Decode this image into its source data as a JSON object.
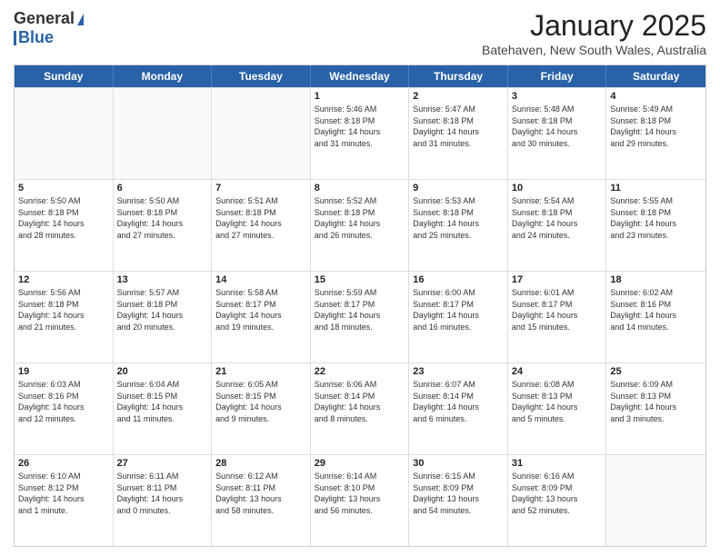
{
  "logo": {
    "line1": "General",
    "line2": "Blue"
  },
  "header": {
    "month": "January 2025",
    "location": "Batehaven, New South Wales, Australia"
  },
  "days": [
    "Sunday",
    "Monday",
    "Tuesday",
    "Wednesday",
    "Thursday",
    "Friday",
    "Saturday"
  ],
  "weeks": [
    [
      {
        "day": "",
        "empty": true
      },
      {
        "day": "",
        "empty": true
      },
      {
        "day": "",
        "empty": true
      },
      {
        "day": "1",
        "line1": "Sunrise: 5:46 AM",
        "line2": "Sunset: 8:18 PM",
        "line3": "Daylight: 14 hours",
        "line4": "and 31 minutes."
      },
      {
        "day": "2",
        "line1": "Sunrise: 5:47 AM",
        "line2": "Sunset: 8:18 PM",
        "line3": "Daylight: 14 hours",
        "line4": "and 31 minutes."
      },
      {
        "day": "3",
        "line1": "Sunrise: 5:48 AM",
        "line2": "Sunset: 8:18 PM",
        "line3": "Daylight: 14 hours",
        "line4": "and 30 minutes."
      },
      {
        "day": "4",
        "line1": "Sunrise: 5:49 AM",
        "line2": "Sunset: 8:18 PM",
        "line3": "Daylight: 14 hours",
        "line4": "and 29 minutes."
      }
    ],
    [
      {
        "day": "5",
        "line1": "Sunrise: 5:50 AM",
        "line2": "Sunset: 8:18 PM",
        "line3": "Daylight: 14 hours",
        "line4": "and 28 minutes."
      },
      {
        "day": "6",
        "line1": "Sunrise: 5:50 AM",
        "line2": "Sunset: 8:18 PM",
        "line3": "Daylight: 14 hours",
        "line4": "and 27 minutes."
      },
      {
        "day": "7",
        "line1": "Sunrise: 5:51 AM",
        "line2": "Sunset: 8:18 PM",
        "line3": "Daylight: 14 hours",
        "line4": "and 27 minutes."
      },
      {
        "day": "8",
        "line1": "Sunrise: 5:52 AM",
        "line2": "Sunset: 8:18 PM",
        "line3": "Daylight: 14 hours",
        "line4": "and 26 minutes."
      },
      {
        "day": "9",
        "line1": "Sunrise: 5:53 AM",
        "line2": "Sunset: 8:18 PM",
        "line3": "Daylight: 14 hours",
        "line4": "and 25 minutes."
      },
      {
        "day": "10",
        "line1": "Sunrise: 5:54 AM",
        "line2": "Sunset: 8:18 PM",
        "line3": "Daylight: 14 hours",
        "line4": "and 24 minutes."
      },
      {
        "day": "11",
        "line1": "Sunrise: 5:55 AM",
        "line2": "Sunset: 8:18 PM",
        "line3": "Daylight: 14 hours",
        "line4": "and 23 minutes."
      }
    ],
    [
      {
        "day": "12",
        "line1": "Sunrise: 5:56 AM",
        "line2": "Sunset: 8:18 PM",
        "line3": "Daylight: 14 hours",
        "line4": "and 21 minutes."
      },
      {
        "day": "13",
        "line1": "Sunrise: 5:57 AM",
        "line2": "Sunset: 8:18 PM",
        "line3": "Daylight: 14 hours",
        "line4": "and 20 minutes."
      },
      {
        "day": "14",
        "line1": "Sunrise: 5:58 AM",
        "line2": "Sunset: 8:17 PM",
        "line3": "Daylight: 14 hours",
        "line4": "and 19 minutes."
      },
      {
        "day": "15",
        "line1": "Sunrise: 5:59 AM",
        "line2": "Sunset: 8:17 PM",
        "line3": "Daylight: 14 hours",
        "line4": "and 18 minutes."
      },
      {
        "day": "16",
        "line1": "Sunrise: 6:00 AM",
        "line2": "Sunset: 8:17 PM",
        "line3": "Daylight: 14 hours",
        "line4": "and 16 minutes."
      },
      {
        "day": "17",
        "line1": "Sunrise: 6:01 AM",
        "line2": "Sunset: 8:17 PM",
        "line3": "Daylight: 14 hours",
        "line4": "and 15 minutes."
      },
      {
        "day": "18",
        "line1": "Sunrise: 6:02 AM",
        "line2": "Sunset: 8:16 PM",
        "line3": "Daylight: 14 hours",
        "line4": "and 14 minutes."
      }
    ],
    [
      {
        "day": "19",
        "line1": "Sunrise: 6:03 AM",
        "line2": "Sunset: 8:16 PM",
        "line3": "Daylight: 14 hours",
        "line4": "and 12 minutes."
      },
      {
        "day": "20",
        "line1": "Sunrise: 6:04 AM",
        "line2": "Sunset: 8:15 PM",
        "line3": "Daylight: 14 hours",
        "line4": "and 11 minutes."
      },
      {
        "day": "21",
        "line1": "Sunrise: 6:05 AM",
        "line2": "Sunset: 8:15 PM",
        "line3": "Daylight: 14 hours",
        "line4": "and 9 minutes."
      },
      {
        "day": "22",
        "line1": "Sunrise: 6:06 AM",
        "line2": "Sunset: 8:14 PM",
        "line3": "Daylight: 14 hours",
        "line4": "and 8 minutes."
      },
      {
        "day": "23",
        "line1": "Sunrise: 6:07 AM",
        "line2": "Sunset: 8:14 PM",
        "line3": "Daylight: 14 hours",
        "line4": "and 6 minutes."
      },
      {
        "day": "24",
        "line1": "Sunrise: 6:08 AM",
        "line2": "Sunset: 8:13 PM",
        "line3": "Daylight: 14 hours",
        "line4": "and 5 minutes."
      },
      {
        "day": "25",
        "line1": "Sunrise: 6:09 AM",
        "line2": "Sunset: 8:13 PM",
        "line3": "Daylight: 14 hours",
        "line4": "and 3 minutes."
      }
    ],
    [
      {
        "day": "26",
        "line1": "Sunrise: 6:10 AM",
        "line2": "Sunset: 8:12 PM",
        "line3": "Daylight: 14 hours",
        "line4": "and 1 minute."
      },
      {
        "day": "27",
        "line1": "Sunrise: 6:11 AM",
        "line2": "Sunset: 8:11 PM",
        "line3": "Daylight: 14 hours",
        "line4": "and 0 minutes."
      },
      {
        "day": "28",
        "line1": "Sunrise: 6:12 AM",
        "line2": "Sunset: 8:11 PM",
        "line3": "Daylight: 13 hours",
        "line4": "and 58 minutes."
      },
      {
        "day": "29",
        "line1": "Sunrise: 6:14 AM",
        "line2": "Sunset: 8:10 PM",
        "line3": "Daylight: 13 hours",
        "line4": "and 56 minutes."
      },
      {
        "day": "30",
        "line1": "Sunrise: 6:15 AM",
        "line2": "Sunset: 8:09 PM",
        "line3": "Daylight: 13 hours",
        "line4": "and 54 minutes."
      },
      {
        "day": "31",
        "line1": "Sunrise: 6:16 AM",
        "line2": "Sunset: 8:09 PM",
        "line3": "Daylight: 13 hours",
        "line4": "and 52 minutes."
      },
      {
        "day": "",
        "empty": true
      }
    ]
  ]
}
